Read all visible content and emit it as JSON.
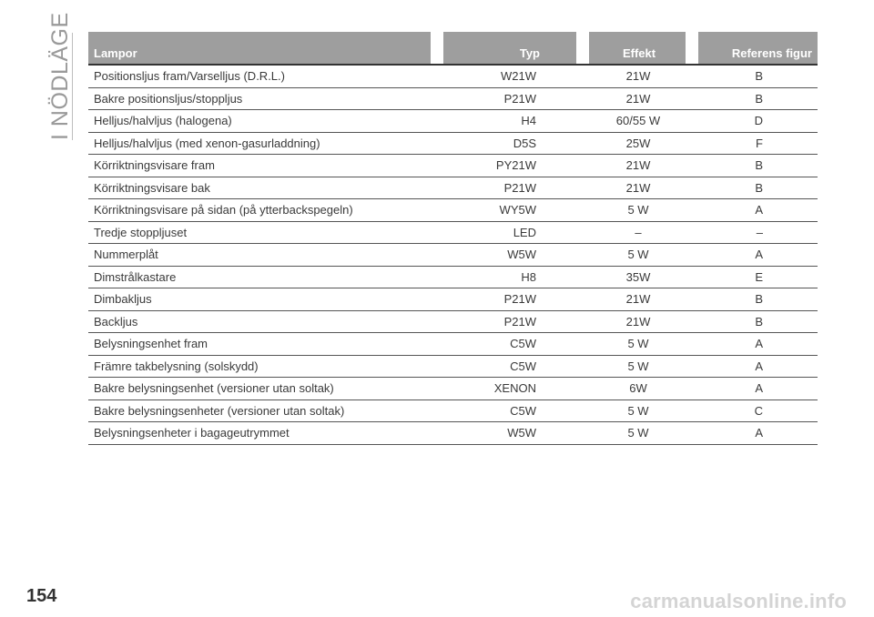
{
  "section_title": "I NÖDLÄGE",
  "page_number": "154",
  "watermark": "carmanualsonline.info",
  "table": {
    "headers": [
      "Lampor",
      "Typ",
      "Effekt",
      "Referens figur"
    ],
    "rows": [
      [
        "Positionsljus fram/Varselljus (D.R.L.)",
        "W21W",
        "21W",
        "B"
      ],
      [
        "Bakre positionsljus/stoppljus",
        "P21W",
        "21W",
        "B"
      ],
      [
        "Helljus/halvljus (halogena)",
        "H4",
        "60/55 W",
        "D"
      ],
      [
        "Helljus/halvljus (med xenon-gasurladdning)",
        "D5S",
        "25W",
        "F"
      ],
      [
        "Körriktningsvisare fram",
        "PY21W",
        "21W",
        "B"
      ],
      [
        "Körriktningsvisare bak",
        "P21W",
        "21W",
        "B"
      ],
      [
        "Körriktningsvisare på sidan (på ytterbackspegeln)",
        "WY5W",
        "5 W",
        "A"
      ],
      [
        "Tredje stoppljuset",
        "LED",
        "–",
        "–"
      ],
      [
        "Nummerplåt",
        "W5W",
        "5 W",
        "A"
      ],
      [
        "Dimstrålkastare",
        "H8",
        "35W",
        "E"
      ],
      [
        "Dimbakljus",
        "P21W",
        "21W",
        "B"
      ],
      [
        "Backljus",
        "P21W",
        "21W",
        "B"
      ],
      [
        "Belysningsenhet fram",
        "C5W",
        "5 W",
        "A"
      ],
      [
        "Främre takbelysning (solskydd)",
        "C5W",
        "5 W",
        "A"
      ],
      [
        "Bakre belysningsenhet (versioner utan soltak)",
        "XENON",
        "6W",
        "A"
      ],
      [
        "Bakre belysningsenheter (versioner utan soltak)",
        "C5W",
        "5 W",
        "C"
      ],
      [
        "Belysningsenheter i bagageutrymmet",
        "W5W",
        "5 W",
        "A"
      ]
    ]
  },
  "colors": {
    "header_bg": "#9e9e9e",
    "header_text": "#ffffff",
    "side_title": "#9a9a9a"
  }
}
